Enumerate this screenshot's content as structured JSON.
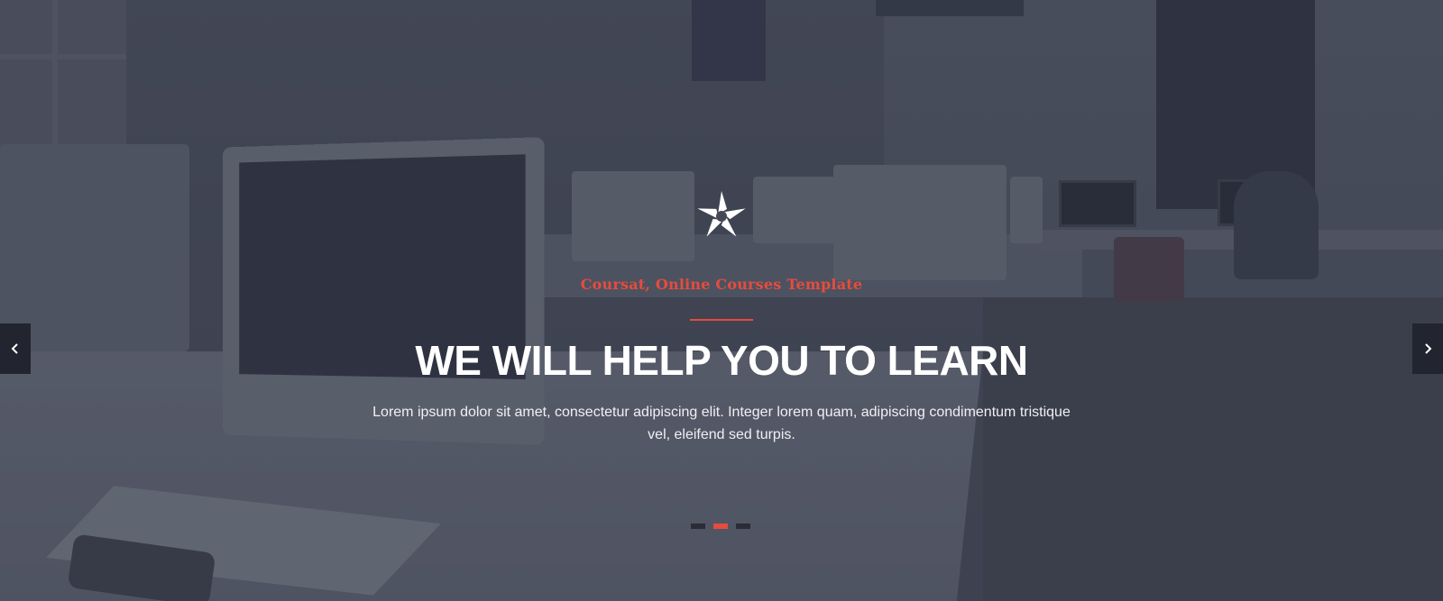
{
  "hero": {
    "tagline": "Coursat, Online Courses Template",
    "headline": "WE WILL HELP YOU TO LEARN",
    "description": "Lorem ipsum dolor sit amet, consectetur adipiscing elit. Integer lorem quam, adipiscing condimentum tristique vel, eleifend sed turpis.",
    "logo_icon": "star-logo-icon"
  },
  "carousel": {
    "prev_icon": "chevron-left-icon",
    "next_icon": "chevron-right-icon",
    "slide_count": 3,
    "active_slide": 2
  },
  "colors": {
    "accent": "#e74c3c",
    "text": "#ffffff",
    "arrow_bg": "#22242f",
    "dot_inactive": "#2a2c36"
  }
}
